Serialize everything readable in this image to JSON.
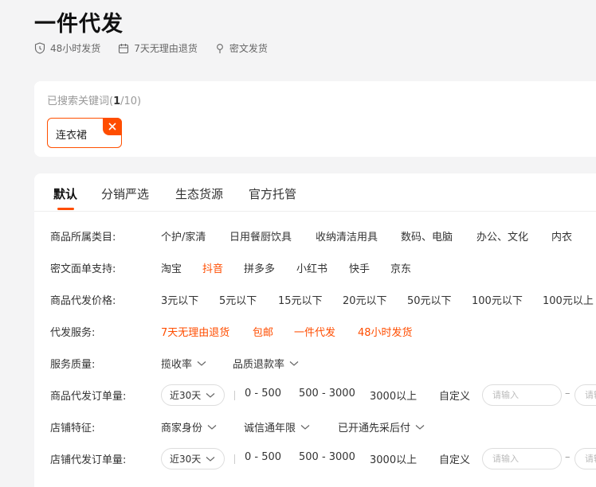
{
  "header": {
    "title": "一件代发",
    "features": [
      {
        "icon": "clock-shield-icon",
        "label": "48小时发货"
      },
      {
        "icon": "calendar-icon",
        "label": "7天无理由退货"
      },
      {
        "icon": "pin-icon",
        "label": "密文发货"
      }
    ]
  },
  "search": {
    "label_prefix": "已搜索关键词(",
    "count_current": "1",
    "count_rest": "/10)",
    "keyword": "连衣裙"
  },
  "tabs": [
    "默认",
    "分销严选",
    "生态货源",
    "官方托管"
  ],
  "filters": {
    "category": {
      "label": "商品所属类目:",
      "options": [
        "个护/家清",
        "日用餐厨饮具",
        "收纳清洁用具",
        "数码、电脑",
        "办公、文化",
        "内衣"
      ]
    },
    "platform": {
      "label": "密文面单支持:",
      "options": [
        "淘宝",
        "抖音",
        "拼多多",
        "小红书",
        "快手",
        "京东"
      ]
    },
    "price": {
      "label": "商品代发价格:",
      "options": [
        "3元以下",
        "5元以下",
        "15元以下",
        "20元以下",
        "50元以下",
        "100元以下",
        "100元以上"
      ]
    },
    "service": {
      "label": "代发服务:",
      "options": [
        "7天无理由退货",
        "包邮",
        "一件代发",
        "48小时发货"
      ]
    },
    "quality": {
      "label": "服务质量:",
      "options": [
        "揽收率",
        "品质退款率"
      ]
    },
    "product_orders": {
      "label": "商品代发订单量:",
      "period": "近30天",
      "ranges": [
        "0 - 500",
        "500 - 3000",
        "3000以上"
      ],
      "custom": "自定义",
      "placeholder": "请输入",
      "placeholder2": "请输"
    },
    "shop_features": {
      "label": "店铺特征:",
      "options": [
        "商家身份",
        "诚信通年限",
        "已开通先采后付"
      ]
    },
    "shop_orders": {
      "label": "店铺代发订单量:",
      "period": "近30天",
      "ranges": [
        "0 - 500",
        "500 - 3000",
        "3000以上"
      ],
      "custom": "自定义",
      "placeholder": "请输入",
      "placeholder2": "请输"
    }
  },
  "colors": {
    "accent": "#ff4d00",
    "background": "#f4f4f5"
  }
}
